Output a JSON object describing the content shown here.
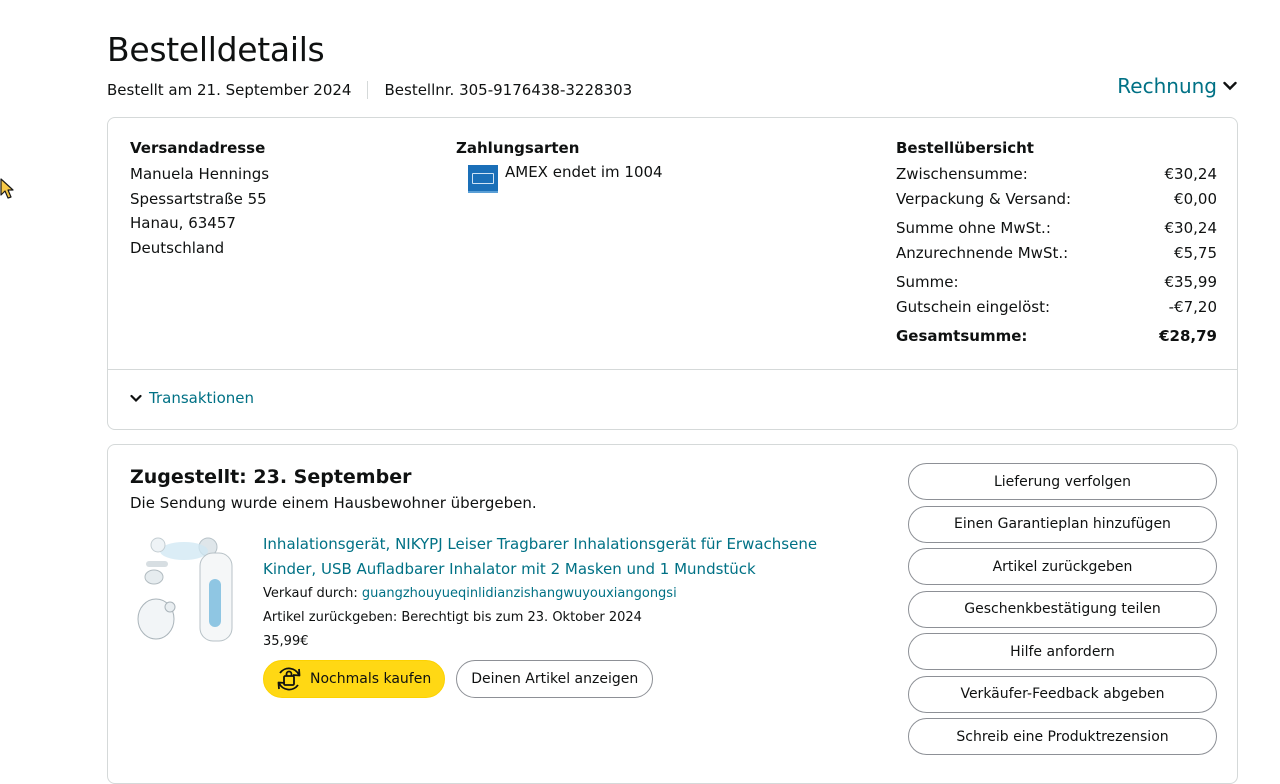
{
  "header": {
    "title": "Bestelldetails",
    "ordered_on": "Bestellt am 21. September 2024",
    "order_number": "Bestellnr. 305-9176438-3228303",
    "invoice_label": "Rechnung"
  },
  "shipping": {
    "heading": "Versandadresse",
    "lines": [
      "Manuela Hennings",
      "Spessartstraße 55",
      "Hanau, 63457",
      "Deutschland"
    ]
  },
  "payment": {
    "heading": "Zahlungsarten",
    "method": "AMEX endet im 1004",
    "card_icon": "amex-card-icon"
  },
  "summary": {
    "heading": "Bestellübersicht",
    "rows": [
      {
        "label": "Zwischensumme:",
        "value": "€30,24"
      },
      {
        "label": "Verpackung & Versand:",
        "value": "€0,00"
      },
      {
        "label": "Summe ohne MwSt.:",
        "value": "€30,24"
      },
      {
        "label": "Anzurechnende MwSt.:",
        "value": "€5,75"
      },
      {
        "label": "Summe:",
        "value": "€35,99"
      },
      {
        "label": "Gutschein eingelöst:",
        "value": "-€7,20"
      },
      {
        "label": "Gesamtsumme:",
        "value": "€28,79"
      }
    ]
  },
  "transactions_label": "Transaktionen",
  "shipment": {
    "title": "Zugestellt: 23. September",
    "subtitle": "Die Sendung wurde einem Hausbewohner übergeben.",
    "item": {
      "title": "Inhalationsgerät, NIKYPJ Leiser Tragbarer Inhalationsgerät für Erwachsene Kinder, USB Aufladbarer Inhalator mit 2 Masken und 1 Mundstück",
      "seller_prefix": "Verkauf durch:",
      "seller": "guangzhouyueqinlidianzishangwuyouxiangongsi",
      "return_info": "Artikel zurückgeben: Berechtigt bis zum 23. Oktober 2024",
      "price": "35,99€",
      "buy_again_label": "Nochmals kaufen",
      "view_item_label": "Deinen Artikel anzeigen"
    },
    "actions": [
      "Lieferung verfolgen",
      "Einen Garantieplan hinzufügen",
      "Artikel zurückgeben",
      "Geschenkbestätigung teilen",
      "Hilfe anfordern",
      "Verkäufer-Feedback abgeben",
      "Schreib eine Produktrezension"
    ]
  },
  "colors": {
    "link": "#007185",
    "buy_again_button": "#ffd814",
    "border": "#d5d9d9",
    "text": "#0f1111"
  }
}
